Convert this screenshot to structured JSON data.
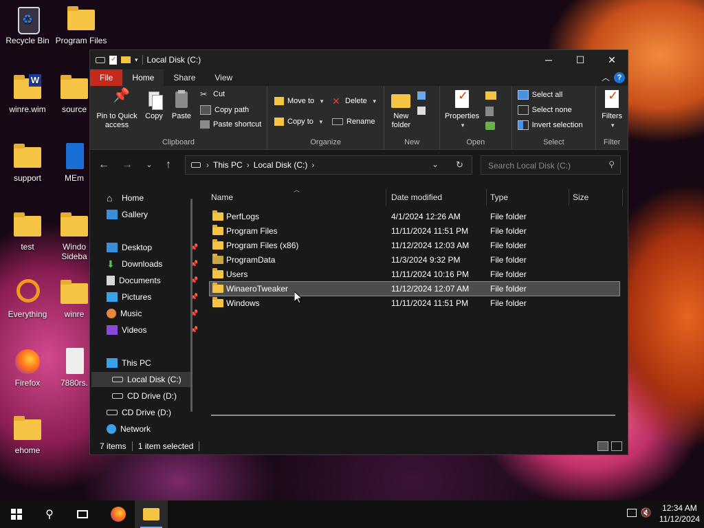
{
  "desktop": {
    "icons": [
      {
        "label": "Recycle Bin"
      },
      {
        "label": "Program Files"
      },
      {
        "label": "winre.wim"
      },
      {
        "label": "source"
      },
      {
        "label": "support"
      },
      {
        "label": "MEm"
      },
      {
        "label": "test"
      },
      {
        "label": "Windo Sideba"
      },
      {
        "label": "Everything"
      },
      {
        "label": "winre"
      },
      {
        "label": "Firefox"
      },
      {
        "label": "7880rs."
      },
      {
        "label": "ehome"
      }
    ]
  },
  "window": {
    "title": "Local Disk (C:)",
    "tabs": {
      "file": "File",
      "home": "Home",
      "share": "Share",
      "view": "View"
    },
    "ribbon": {
      "clipboard": {
        "group": "Clipboard",
        "pin": "Pin to Quick access",
        "copy": "Copy",
        "paste": "Paste",
        "cut": "Cut",
        "copy_path": "Copy path",
        "paste_shortcut": "Paste shortcut"
      },
      "organize": {
        "group": "Organize",
        "move_to": "Move to",
        "copy_to": "Copy to",
        "delete": "Delete",
        "rename": "Rename"
      },
      "new": {
        "group": "New",
        "new_folder": "New folder"
      },
      "open": {
        "group": "Open",
        "properties": "Properties"
      },
      "select": {
        "group": "Select",
        "select_all": "Select all",
        "select_none": "Select none",
        "invert": "Invert selection"
      },
      "filter": {
        "group": "Filter",
        "filters": "Filters"
      }
    },
    "address": {
      "this_pc": "This PC",
      "local_disk": "Local Disk (C:)"
    },
    "search_placeholder": "Search Local Disk (C:)",
    "nav_pane": {
      "home": "Home",
      "gallery": "Gallery",
      "desktop": "Desktop",
      "downloads": "Downloads",
      "documents": "Documents",
      "pictures": "Pictures",
      "music": "Music",
      "videos": "Videos",
      "this_pc": "This PC",
      "local_disk": "Local Disk (C:)",
      "cd_drive_1": "CD Drive (D:)",
      "cd_drive_2": "CD Drive (D:)",
      "network": "Network"
    },
    "columns": {
      "name": "Name",
      "date": "Date modified",
      "type": "Type",
      "size": "Size"
    },
    "files": [
      {
        "name": "PerfLogs",
        "date": "4/1/2024 12:26 AM",
        "type": "File folder"
      },
      {
        "name": "Program Files",
        "date": "11/11/2024 11:51 PM",
        "type": "File folder"
      },
      {
        "name": "Program Files (x86)",
        "date": "11/12/2024 12:03 AM",
        "type": "File folder"
      },
      {
        "name": "ProgramData",
        "date": "11/3/2024 9:32 PM",
        "type": "File folder"
      },
      {
        "name": "Users",
        "date": "11/11/2024 10:16 PM",
        "type": "File folder"
      },
      {
        "name": "WinaeroTweaker",
        "date": "11/12/2024 12:07 AM",
        "type": "File folder"
      },
      {
        "name": "Windows",
        "date": "11/11/2024 11:51 PM",
        "type": "File folder"
      }
    ],
    "status": {
      "items": "7 items",
      "selected": "1 item selected"
    }
  },
  "taskbar": {
    "time": "12:34 AM",
    "date": "11/12/2024"
  },
  "colors": {
    "file_tab": "#c42b1c",
    "folder": "#f6c444",
    "window_bg": "#191919",
    "ribbon_bg": "#2b2b2b"
  }
}
